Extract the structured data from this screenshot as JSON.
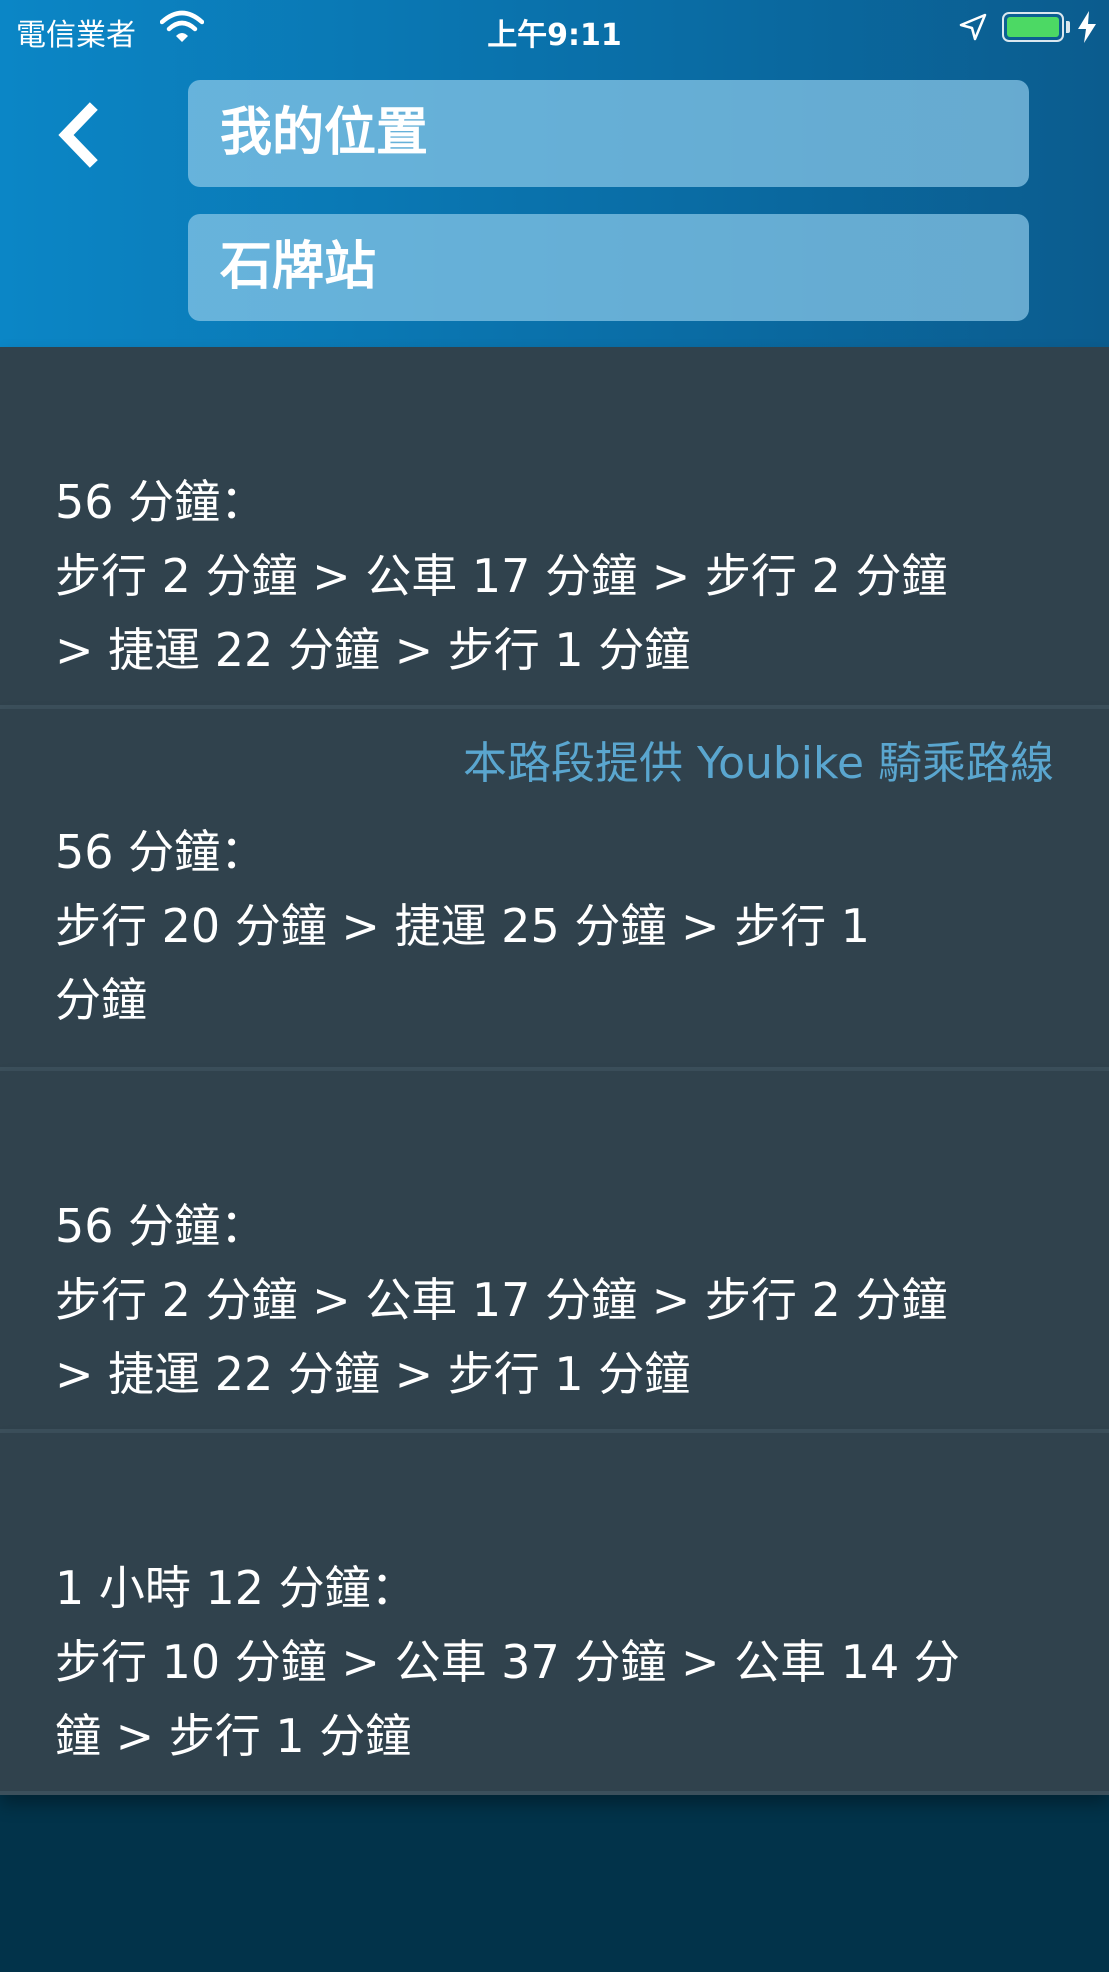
{
  "status_bar": {
    "carrier": "電信業者",
    "time": "上午9:11",
    "battery_color": "#4cd964"
  },
  "header": {
    "origin": "我的位置",
    "destination": "石牌站",
    "back_icon": "chevron-left-icon",
    "gradient_colors": [
      "#0b86c6",
      "#0b5c8e"
    ]
  },
  "routes": [
    {
      "note": "",
      "lines": [
        "56 分鐘：",
        "步行 2 分鐘 > 公車 17 分鐘 > 步行 2 分鐘",
        "> 捷運 22 分鐘 > 步行 1 分鐘"
      ]
    },
    {
      "note": "本路段提供 Youbike 騎乘路線",
      "lines": [
        "56 分鐘：",
        "步行 20 分鐘 > 捷運 25 分鐘 > 步行 1",
        "分鐘"
      ]
    },
    {
      "note": "",
      "lines": [
        "56 分鐘：",
        "步行 2 分鐘 > 公車 17 分鐘 > 步行 2 分鐘",
        "> 捷運 22 分鐘 > 步行 1 分鐘"
      ]
    },
    {
      "note": "",
      "lines": [
        "1 小時 12 分鐘：",
        "步行 10 分鐘 > 公車 37 分鐘 > 公車 14 分",
        "鐘 > 步行 1 分鐘"
      ]
    }
  ],
  "colors": {
    "card_bg": "#30424d",
    "page_bg": "#02334a",
    "note_color": "#5aa6cf"
  }
}
